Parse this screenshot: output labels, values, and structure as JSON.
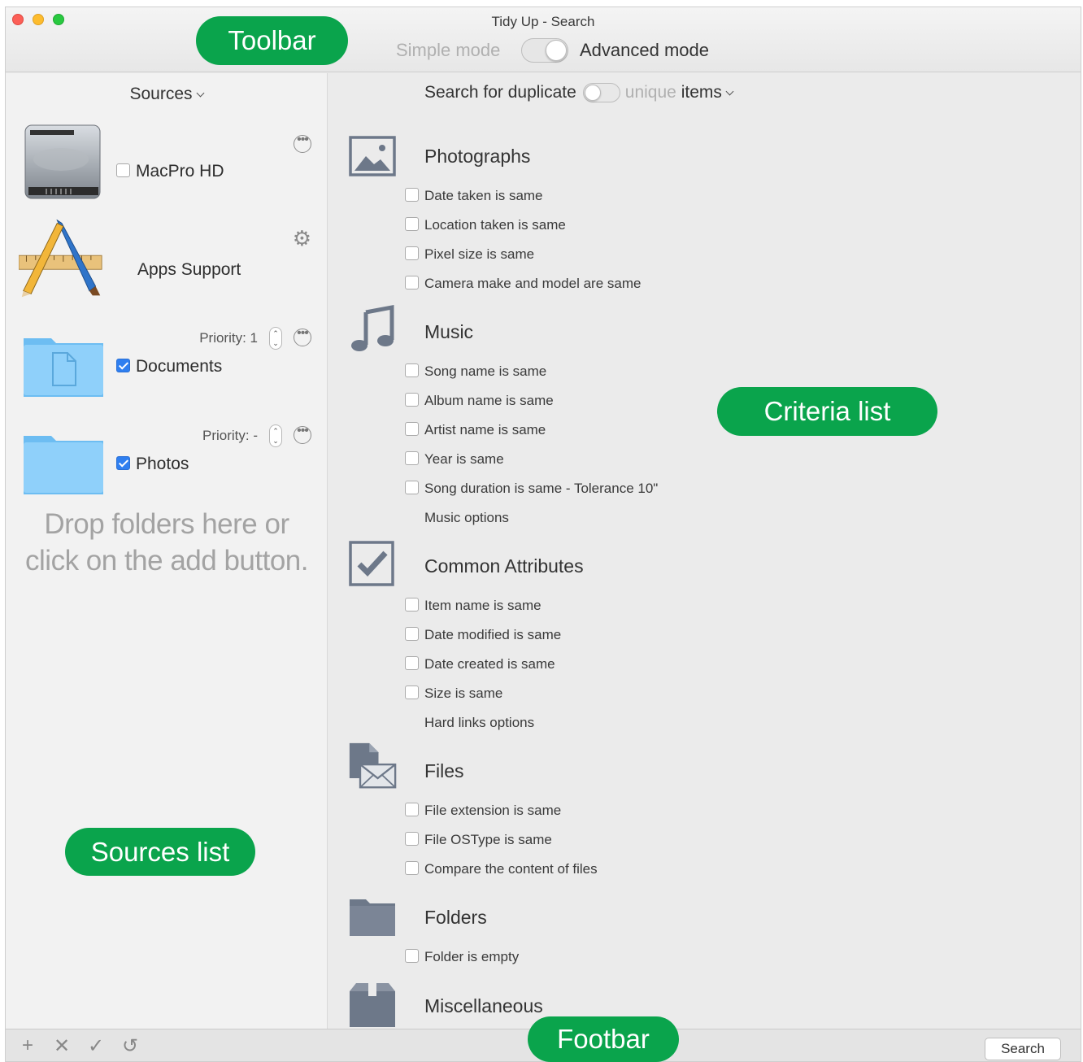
{
  "window": {
    "title": "Tidy Up - Search"
  },
  "toolbar": {
    "simple_mode": "Simple mode",
    "advanced_mode": "Advanced mode"
  },
  "sidebar": {
    "header": "Sources",
    "items": [
      {
        "name": "MacPro HD",
        "icon": "hard-drive-icon",
        "checked": false,
        "action": "more-icon"
      },
      {
        "name": "Apps Support",
        "icon": "applications-icon",
        "action": "gear-icon"
      },
      {
        "name": "Documents",
        "icon": "documents-folder-icon",
        "checked": true,
        "priority": "Priority: 1",
        "action": "more-icon"
      },
      {
        "name": "Photos",
        "icon": "folder-icon",
        "checked": true,
        "priority": "Priority: -",
        "action": "more-icon"
      }
    ],
    "drop_hint_line1": "Drop folders here or",
    "drop_hint_line2": "click on the add button."
  },
  "main": {
    "search_for": "Search for duplicate",
    "unique": "unique",
    "items": "items",
    "categories": [
      {
        "title": "Photographs",
        "icon": "photo-icon",
        "criteria": [
          "Date taken is same",
          "Location taken is same",
          "Pixel size is same",
          "Camera make and model are same"
        ]
      },
      {
        "title": "Music",
        "icon": "music-note-icon",
        "criteria": [
          "Song name is same",
          "Album name is same",
          "Artist name is same",
          "Year is same",
          "Song duration is same - Tolerance 10\""
        ],
        "options": "Music options"
      },
      {
        "title": "Common Attributes",
        "icon": "checkmark-box-icon",
        "criteria": [
          "Item name is same",
          "Date modified is same",
          "Date created is same",
          "Size is same"
        ],
        "options": "Hard links options"
      },
      {
        "title": "Files",
        "icon": "file-icon",
        "criteria": [
          "File extension is same",
          "File OSType is same",
          "Compare the content of files"
        ]
      },
      {
        "title": "Folders",
        "icon": "folder-icon",
        "criteria": [
          "Folder is empty"
        ]
      },
      {
        "title": "Miscellaneous",
        "icon": "box-icon",
        "criteria": []
      }
    ]
  },
  "footbar": {
    "add": "+",
    "remove": "✕",
    "check": "✓",
    "reset": "↺",
    "search": "Search"
  },
  "callouts": {
    "toolbar": "Toolbar",
    "criteria": "Criteria list",
    "sources": "Sources list",
    "footbar": "Footbar"
  },
  "colors": {
    "callout": "#0aa44c",
    "accent": "#2f7ff0",
    "icon_gray": "#6d7889"
  }
}
